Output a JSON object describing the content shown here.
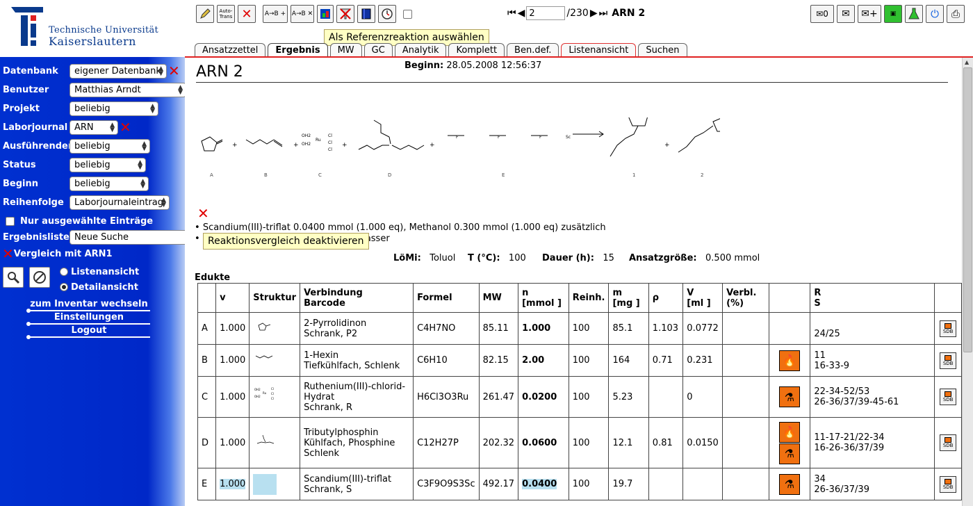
{
  "logo": {
    "line1": "Technische Universität",
    "line2": "Kaiserslautern"
  },
  "sidebar": {
    "fields": [
      {
        "label": "Datenbank",
        "value": "eigener Datenbank"
      },
      {
        "label": "Benutzer",
        "value": "Matthias Arndt"
      },
      {
        "label": "Projekt",
        "value": "beliebig"
      },
      {
        "label": "Laborjournal",
        "value": "ARN"
      },
      {
        "label": "Ausführender",
        "value": "beliebig"
      },
      {
        "label": "Status",
        "value": "beliebig"
      },
      {
        "label": "Beginn",
        "value": "beliebig"
      },
      {
        "label": "Reihenfolge",
        "value": "Laborjournaleintrag"
      }
    ],
    "only_selected": "Nur ausgewählte Einträge",
    "result_label": "Ergebnisliste",
    "result_value": "Neue Suche",
    "compare": "Vergleich mit ARN1",
    "view_list": "Listenansicht",
    "view_detail": "Detailansicht",
    "links": [
      "zum Inventar wechseln",
      "Einstellungen",
      "Logout"
    ]
  },
  "toolbar": {
    "auto_trans": "Auto-Trans",
    "page_value": "2",
    "page_total": "/230",
    "record": "ARN 2",
    "mail_count": "0"
  },
  "tooltips": {
    "ref": "Als Referenzreaktion auswählen",
    "deact": "Reaktionsvergleich deaktivieren"
  },
  "tabs": [
    "Ansatzzettel",
    "Ergebnis",
    "MW",
    "GC",
    "Analytik",
    "Komplett",
    "Ben.def.",
    "Listenansicht",
    "Suchen"
  ],
  "main": {
    "title": "ARN 2",
    "begin_label": "Beginn:",
    "begin_value": "28.05.2008 12:56:37",
    "scheme_labels": [
      "A",
      "B",
      "C",
      "D",
      "E",
      "1",
      "2"
    ],
    "bullet1": "Scandium(III)-triflat 0.0400 mmol (1.000 eq), Methanol 0.300 mmol (1.000 eq) zusätzlich",
    "bullet2": "asser",
    "conditions": {
      "loemi_label": "LöMi:",
      "loemi": "Toluol",
      "t_label": "T (°C):",
      "t": "100",
      "dauer_label": "Dauer (h):",
      "dauer": "15",
      "size_label": "Ansatzgröße:",
      "size": "0.500 mmol"
    },
    "section": "Edukte"
  },
  "table": {
    "headers": {
      "v": "v",
      "struktur": "Struktur",
      "verb1": "Verbindung",
      "verb2": "Barcode",
      "formel": "Formel",
      "mw": "MW",
      "n1": "n",
      "n2": "[mmol ]",
      "reinh": "Reinh.",
      "m1": "m",
      "m2": "[mg ]",
      "rho": "ρ",
      "vol1": "V",
      "vol2": "[ml ]",
      "verbl1": "Verbl.",
      "verbl2": "(%)",
      "r1": "R",
      "r2": "S"
    },
    "rows": [
      {
        "id": "A",
        "v": "1.000",
        "name": "2-Pyrrolidinon",
        "loc": "Schrank, P2",
        "loc2": "",
        "formula": "C4H7NO",
        "mw": "85.11",
        "n": "1.000",
        "reinh": "100",
        "m": "85.1",
        "rho": "1.103",
        "vol": "0.0772",
        "r": "",
        "s": "24/25"
      },
      {
        "id": "B",
        "v": "1.000",
        "name": "1-Hexin",
        "loc": "Tiefkühlfach, Schlenk",
        "loc2": "",
        "formula": "C6H10",
        "mw": "82.15",
        "n": "2.00",
        "reinh": "100",
        "m": "164",
        "rho": "0.71",
        "vol": "0.231",
        "r": "11",
        "s": "16-33-9"
      },
      {
        "id": "C",
        "v": "1.000",
        "name": "Ruthenium(III)-chlorid-",
        "loc": "Hydrat",
        "loc2": "Schrank, R",
        "formula": "H6Cl3O3Ru",
        "mw": "261.47",
        "n": "0.0200",
        "reinh": "100",
        "m": "5.23",
        "rho": "",
        "vol": "0",
        "r": "22-34-52/53",
        "s": "26-36/37/39-45-61"
      },
      {
        "id": "D",
        "v": "1.000",
        "name": "Tributylphosphin",
        "loc": "Kühlfach, Phosphine",
        "loc2": "Schlenk",
        "formula": "C12H27P",
        "mw": "202.32",
        "n": "0.0600",
        "reinh": "100",
        "m": "12.1",
        "rho": "0.81",
        "vol": "0.0150",
        "r": "11-17-21/22-34",
        "s": "16-26-36/37/39"
      },
      {
        "id": "E",
        "v": "1.000",
        "name": "Scandium(III)-triflat",
        "loc": "Schrank, S",
        "loc2": "",
        "formula": "C3F9O9S3Sc",
        "mw": "492.17",
        "n": "0.0400",
        "reinh": "100",
        "m": "19.7",
        "rho": "",
        "vol": "",
        "r": "34",
        "s": "26-36/37/39"
      }
    ],
    "sdb_label": "SDB"
  }
}
